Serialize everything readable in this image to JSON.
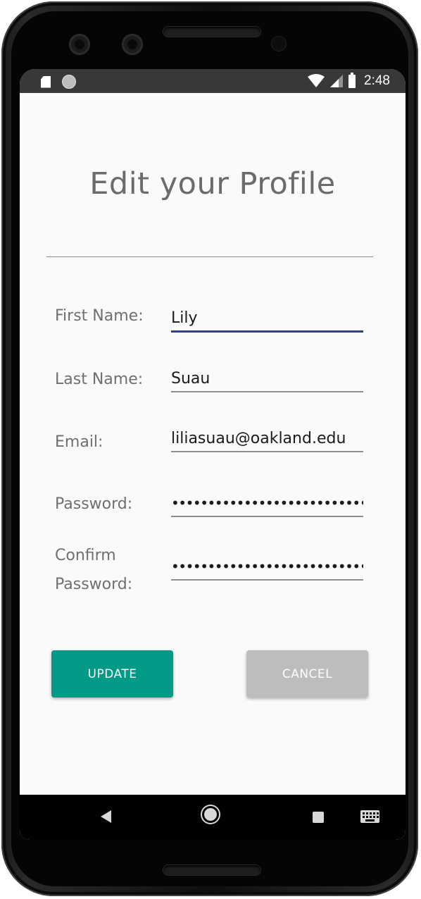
{
  "status_bar": {
    "time": "2:48",
    "left_icons": [
      "sd-card-icon",
      "circle-notification-icon"
    ],
    "right_icons": [
      "wifi-icon",
      "cell-signal-icon",
      "battery-icon"
    ]
  },
  "screen": {
    "title": "Edit your Profile"
  },
  "form": {
    "first_name": {
      "label": "First Name:",
      "value": "Lily"
    },
    "last_name": {
      "label": "Last Name:",
      "value": "Suau"
    },
    "email": {
      "label": "Email:",
      "value": "liliasuau@oakland.edu"
    },
    "password": {
      "label": "Password:",
      "value": "•••••••••••••••••••••••••••••"
    },
    "confirm_password": {
      "label_line1": "Confirm",
      "label_line2": "Password:",
      "value": "•••••••••••••••••••••••••••••"
    }
  },
  "buttons": {
    "update_label": "UPDATE",
    "cancel_label": "CANCEL"
  },
  "colors": {
    "accent_update": "#009a86",
    "cancel_gray": "#bdbdbd",
    "focus_underline": "#2f3e8f",
    "status_bar": "#383838"
  },
  "nav_bar": {
    "icons": [
      "back-icon",
      "home-icon",
      "recents-icon",
      "keyboard-icon"
    ]
  }
}
